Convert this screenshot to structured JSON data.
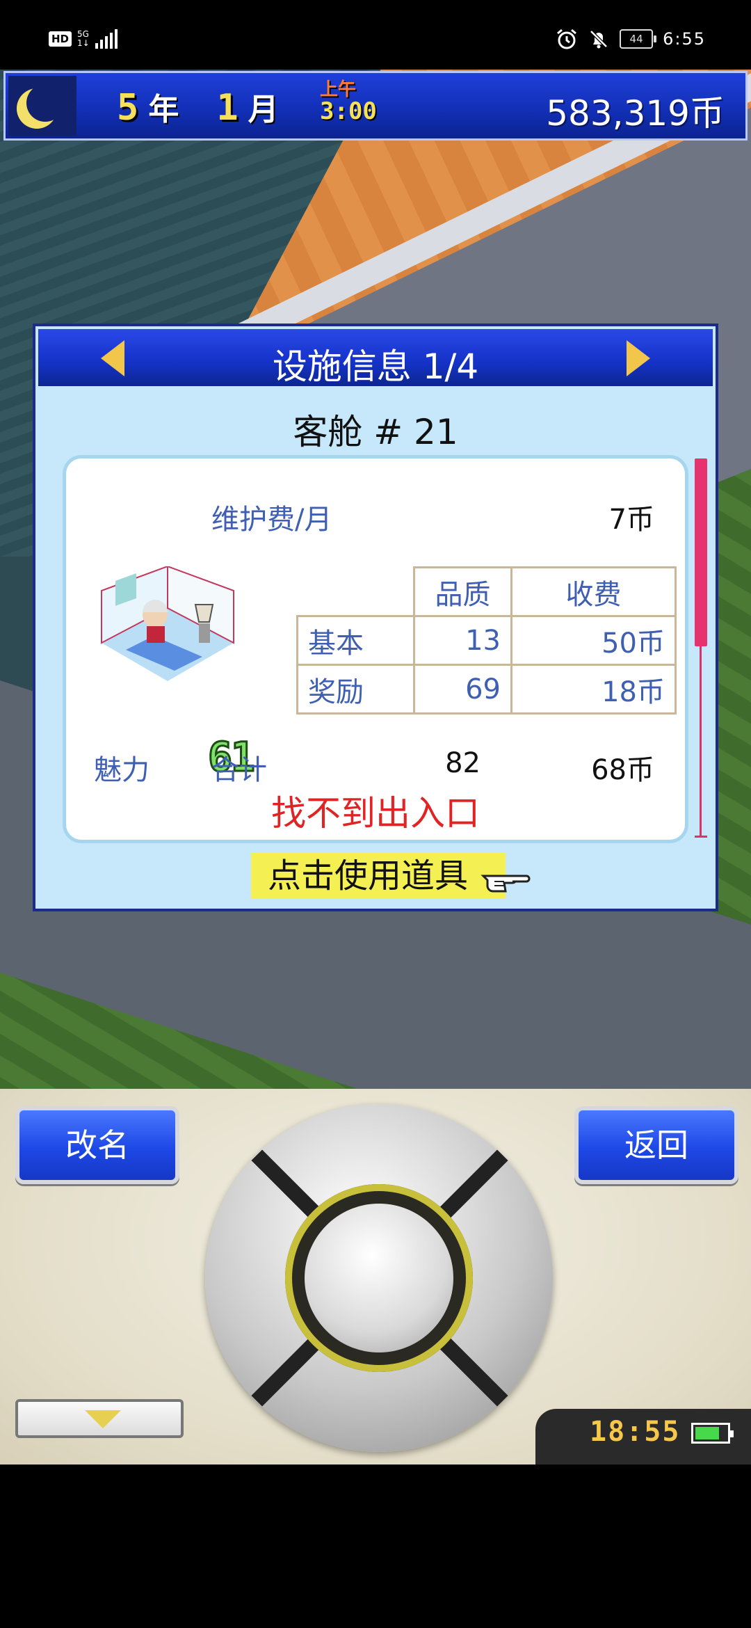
{
  "status_bar": {
    "hd": "HD",
    "network": "5G",
    "network_sub": "1↓",
    "battery": "44",
    "time": "6:55"
  },
  "hud": {
    "year": "5",
    "year_unit": "年",
    "month": "1",
    "month_unit": "月",
    "ampm": "上午",
    "time": "3:00",
    "money": "583,319币"
  },
  "dialog": {
    "title": "设施信息 1/4",
    "room_name": "客舱 # 21",
    "maintenance_label": "维护费/月",
    "maintenance_value": "7币",
    "table": {
      "headers": [
        "",
        "品质",
        "收费"
      ],
      "rows": [
        {
          "label": "基本",
          "quality": "13",
          "fee": "50币"
        },
        {
          "label": "奖励",
          "quality": "69",
          "fee": "18币"
        }
      ]
    },
    "charm_label": "魅力",
    "charm_value": "61",
    "total_label": "合计",
    "total_quality": "82",
    "total_fee": "68币",
    "warning": "找不到出入口",
    "use_item": "点击使用道具"
  },
  "controls": {
    "rename": "改名",
    "back": "返回",
    "clock": "18:55"
  },
  "icons": {
    "status_alarm": "alarm-icon",
    "status_mute": "bell-off-icon",
    "moon": "moon-icon",
    "room": "cabin-room-icon",
    "pointer": "pointing-hand-icon"
  },
  "colors": {
    "hud_blue": "#1230b8",
    "dialog_bg": "#c7e8fa",
    "label_blue": "#3f5fb3",
    "warning_red": "#e02424",
    "highlight_yellow": "#f4f053",
    "scroll_pink": "#e6336e"
  }
}
